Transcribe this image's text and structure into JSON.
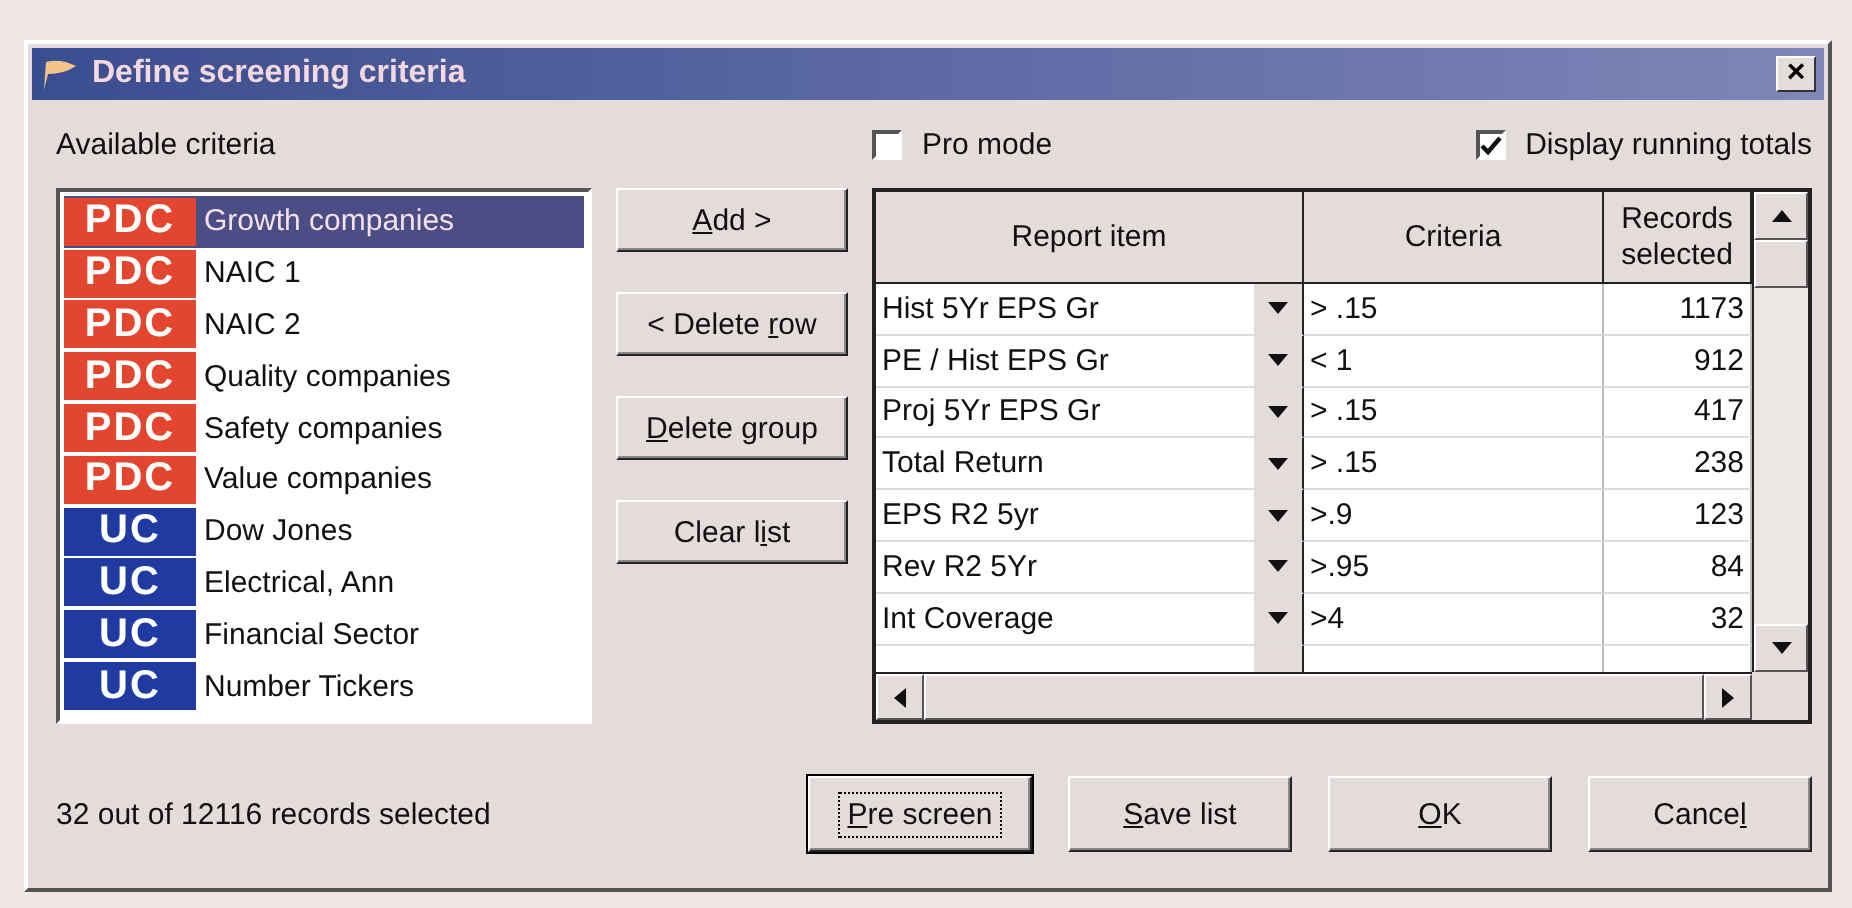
{
  "window": {
    "title": "Define screening criteria",
    "close": "×"
  },
  "criteria_list": {
    "label": "Available criteria",
    "items": [
      {
        "badge": "PDC",
        "kind": "pdc",
        "name": "Growth companies",
        "selected": true
      },
      {
        "badge": "PDC",
        "kind": "pdc",
        "name": "NAIC 1",
        "selected": false
      },
      {
        "badge": "PDC",
        "kind": "pdc",
        "name": "NAIC 2",
        "selected": false
      },
      {
        "badge": "PDC",
        "kind": "pdc",
        "name": "Quality companies",
        "selected": false
      },
      {
        "badge": "PDC",
        "kind": "pdc",
        "name": "Safety companies",
        "selected": false
      },
      {
        "badge": "PDC",
        "kind": "pdc",
        "name": "Value companies",
        "selected": false
      },
      {
        "badge": "UC",
        "kind": "uc",
        "name": "Dow Jones",
        "selected": false
      },
      {
        "badge": "UC",
        "kind": "uc",
        "name": "Electrical, Ann",
        "selected": false
      },
      {
        "badge": "UC",
        "kind": "uc",
        "name": "Financial Sector",
        "selected": false
      },
      {
        "badge": "UC",
        "kind": "uc",
        "name": "Number Tickers",
        "selected": false
      }
    ]
  },
  "side_buttons": [
    {
      "key": "A",
      "post": "dd >"
    },
    {
      "pre": "< Delete ",
      "key": "r",
      "post": "ow"
    },
    {
      "key": "D",
      "post": "elete group"
    },
    {
      "pre": "Clear l",
      "key": "i",
      "post": "st"
    }
  ],
  "options": [
    {
      "label": "Pro mode",
      "checked": false
    },
    {
      "label": "Display running totals",
      "checked": true
    }
  ],
  "table": {
    "columns": [
      "Report item",
      "Criteria",
      "Records selected"
    ],
    "rows": [
      {
        "item": "Hist 5Yr EPS Gr",
        "criteria": "> .15",
        "records": "1173"
      },
      {
        "item": "PE / Hist EPS Gr",
        "criteria": "< 1",
        "records": "912"
      },
      {
        "item": "Proj 5Yr EPS Gr",
        "criteria": "> .15",
        "records": "417"
      },
      {
        "item": "Total Return",
        "criteria": "> .15",
        "records": "238"
      },
      {
        "item": "EPS R2 5yr",
        "criteria": ">.9",
        "records": "123"
      },
      {
        "item": "Rev R2 5Yr",
        "criteria": ">.95",
        "records": "84"
      },
      {
        "item": "Int Coverage",
        "criteria": ">4",
        "records": "32"
      }
    ]
  },
  "status": "32 out of 12116 records selected",
  "bottom_buttons": [
    {
      "key": "P",
      "post": "re screen",
      "focused": true
    },
    {
      "key": "S",
      "post": "ave list",
      "focused": false
    },
    {
      "key": "O",
      "post": "K",
      "focused": false
    },
    {
      "pre": "Cance",
      "key": "l",
      "focused": false
    }
  ]
}
